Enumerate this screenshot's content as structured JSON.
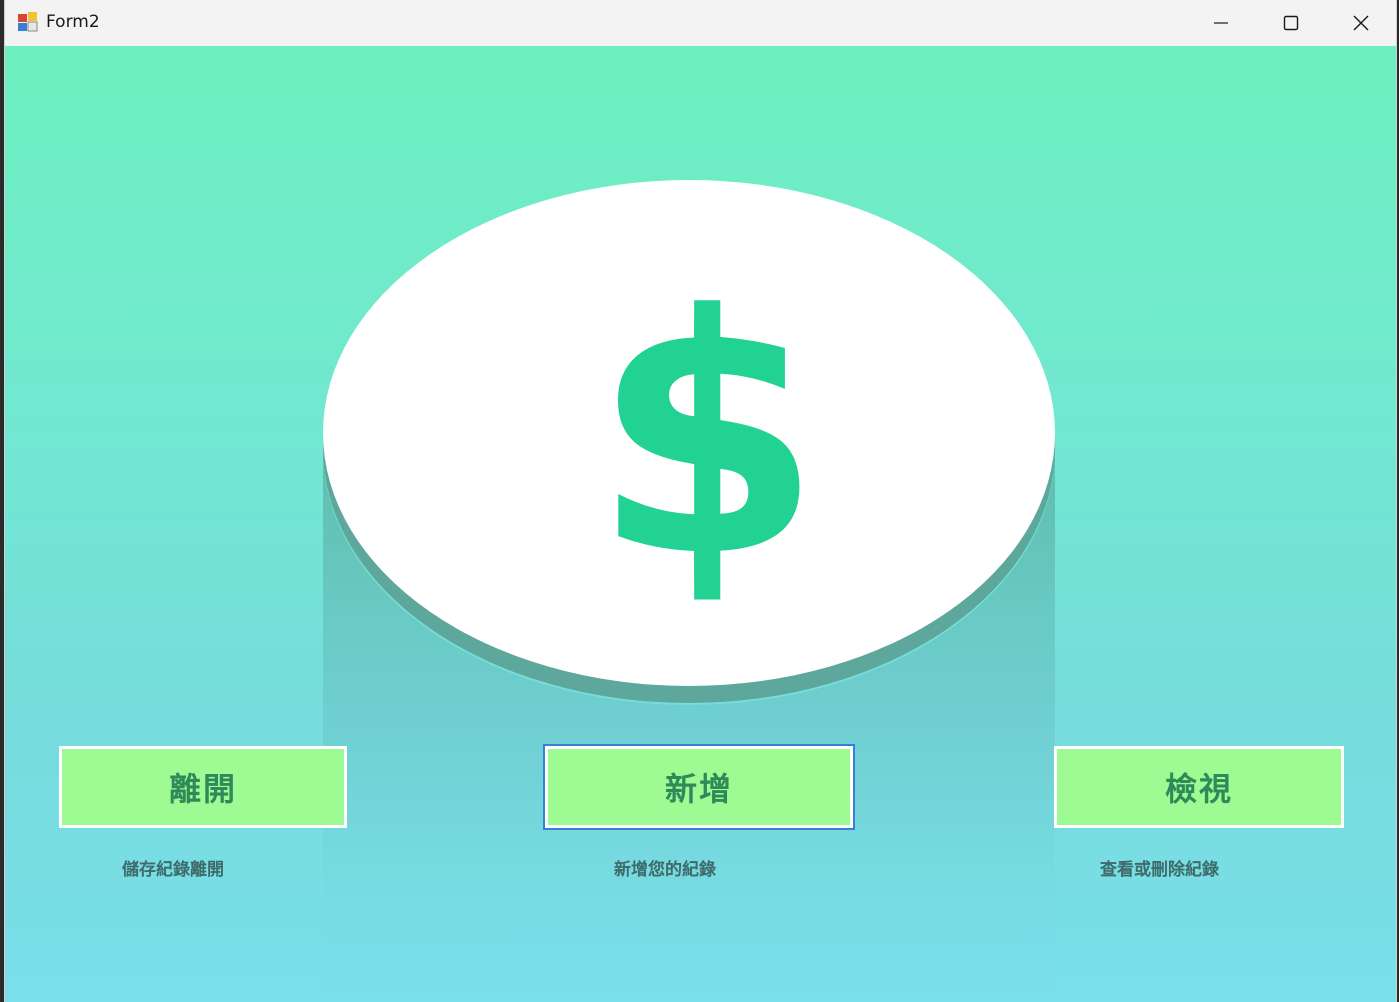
{
  "window": {
    "title": "Form2"
  },
  "titlebar_icons": {
    "app": "app-form-icon",
    "minimize": "minimize-icon",
    "maximize": "maximize-icon",
    "close": "close-icon"
  },
  "hero": {
    "symbol": "$",
    "icon": "dollar-coin-icon",
    "colors": {
      "coin": "#ffffff",
      "symbol": "#22d292",
      "shadow": "#5ea79d"
    }
  },
  "buttons": [
    {
      "label": "離開",
      "caption": "儲存紀錄離開"
    },
    {
      "label": "新增",
      "caption": "新增您的紀錄"
    },
    {
      "label": "檢視",
      "caption": "查看或刪除紀錄"
    }
  ],
  "colors": {
    "background_top": "#6df0bf",
    "background_bottom": "#79dfea",
    "button_fill": "#9efb93",
    "button_text": "#2f8a5a",
    "focus_outline": "#3a7fd6",
    "caption_text": "#3f6b6b"
  }
}
